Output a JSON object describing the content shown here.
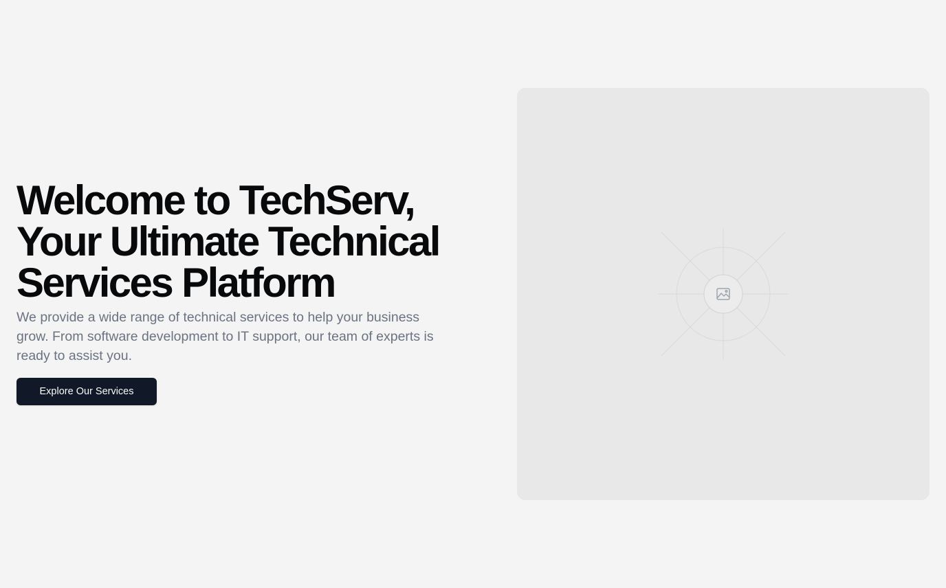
{
  "hero": {
    "headline_line1": "Welcome to TechServ,",
    "headline_line2": "Your Ultimate Technical",
    "headline_line3": "Services Platform",
    "description": "We provide a wide range of technical services to help your business grow. From software development to IT support, our team of experts is ready to assist you.",
    "cta_label": "Explore Our Services"
  },
  "image_placeholder": {
    "icon": "image-icon"
  },
  "colors": {
    "page_background": "#f4f4f4",
    "headline": "#08090b",
    "description": "#6b7280",
    "button_background": "#111827",
    "button_text": "#f9fafb",
    "placeholder_background": "#e8e8e8"
  }
}
